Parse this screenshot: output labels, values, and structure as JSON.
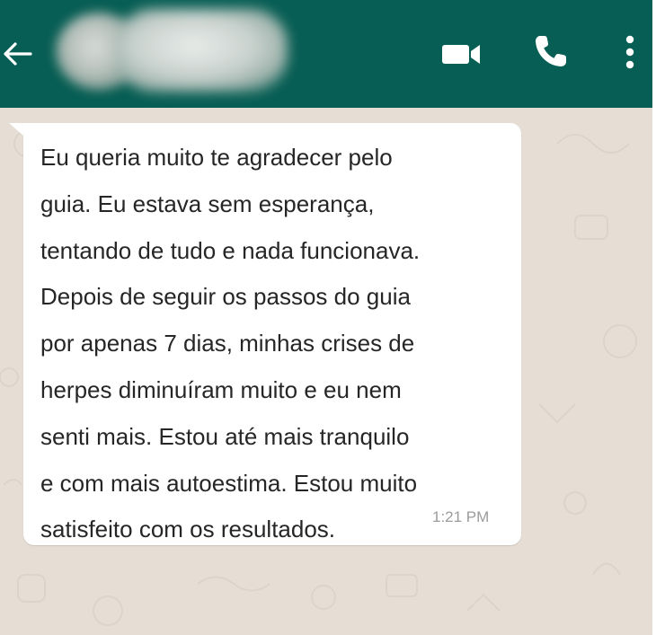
{
  "header": {
    "contact_name": "",
    "icons": {
      "back": "arrow-left-icon",
      "video": "video-camera-icon",
      "call": "phone-icon",
      "menu": "more-vertical-icon"
    },
    "colors": {
      "bar": "#075e54",
      "icon": "#ffffff"
    }
  },
  "chat": {
    "background_color": "#e6ded4",
    "messages": [
      {
        "direction": "incoming",
        "lines": [
          "Eu queria muito te agradecer pelo",
          "guia. Eu estava sem esperança,",
          "tentando de tudo e nada funcionava.",
          "Depois de seguir os passos do guia",
          "por apenas 7 dias, minhas crises de",
          "herpes diminuíram muito e eu nem",
          "senti mais. Estou até mais tranquilo",
          "e com mais autoestima. Estou muito",
          "satisfeito com os resultados."
        ],
        "time": "1:21 PM"
      }
    ]
  }
}
